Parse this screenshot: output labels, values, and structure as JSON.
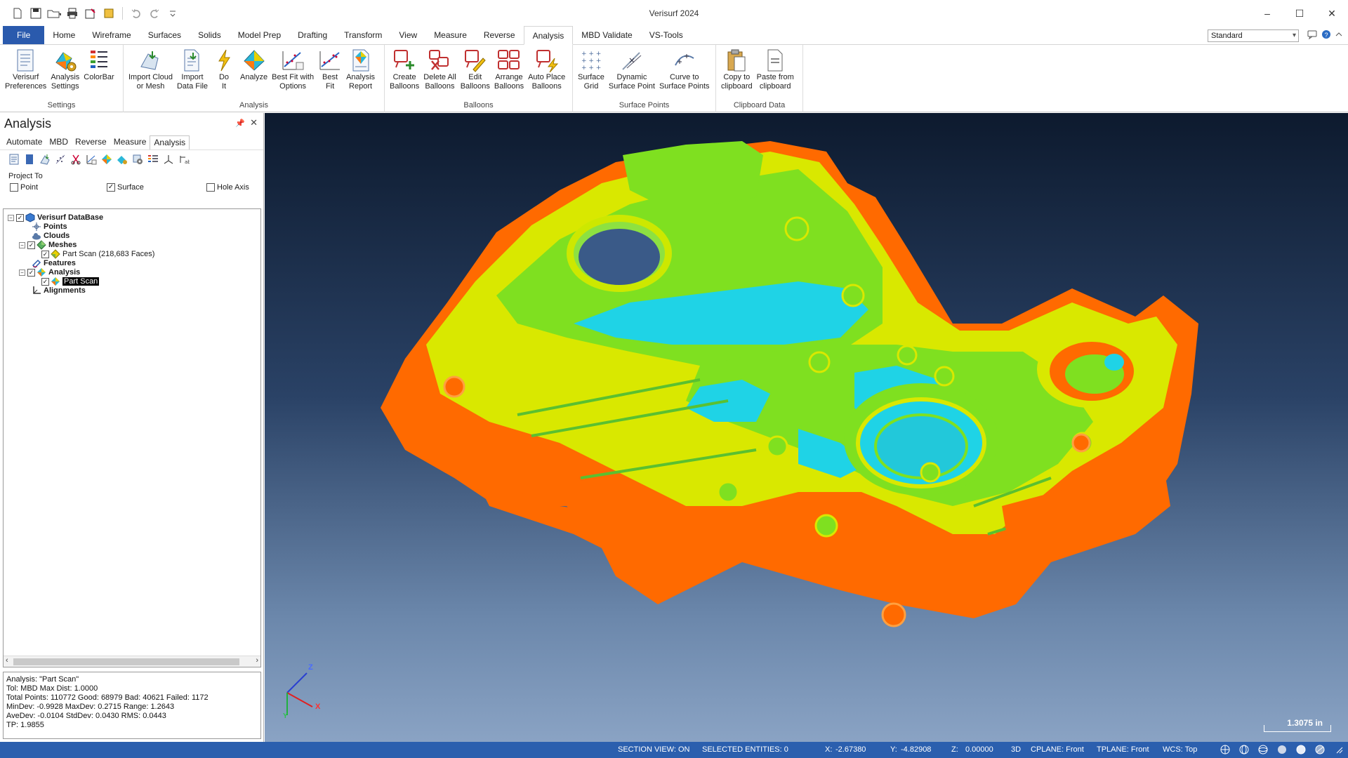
{
  "window": {
    "title": "Verisurf 2024"
  },
  "ribbon_tabs": [
    {
      "label": "File"
    },
    {
      "label": "Home"
    },
    {
      "label": "Wireframe"
    },
    {
      "label": "Surfaces"
    },
    {
      "label": "Solids"
    },
    {
      "label": "Model Prep"
    },
    {
      "label": "Drafting"
    },
    {
      "label": "Transform"
    },
    {
      "label": "View"
    },
    {
      "label": "Measure"
    },
    {
      "label": "Reverse"
    },
    {
      "label": "Analysis"
    },
    {
      "label": "MBD Validate"
    },
    {
      "label": "VS-Tools"
    }
  ],
  "style_combo": "Standard",
  "ribbon_groups": {
    "settings": {
      "label": "Settings",
      "buttons": [
        {
          "label": "Verisurf\nPreferences"
        },
        {
          "label": "Analysis\nSettings"
        },
        {
          "label": "ColorBar"
        }
      ]
    },
    "analysis": {
      "label": "Analysis",
      "buttons": [
        {
          "label": "Import Cloud\nor Mesh"
        },
        {
          "label": "Import\nData File"
        },
        {
          "label": "Do\nIt"
        },
        {
          "label": "Analyze"
        },
        {
          "label": "Best Fit with\nOptions"
        },
        {
          "label": "Best\nFit"
        },
        {
          "label": "Analysis\nReport"
        }
      ]
    },
    "balloons": {
      "label": "Balloons",
      "buttons": [
        {
          "label": "Create\nBalloons"
        },
        {
          "label": "Delete All\nBalloons"
        },
        {
          "label": "Edit\nBalloons"
        },
        {
          "label": "Arrange\nBalloons"
        },
        {
          "label": "Auto Place\nBalloons"
        }
      ]
    },
    "surface_points": {
      "label": "Surface Points",
      "buttons": [
        {
          "label": "Surface\nGrid"
        },
        {
          "label": "Dynamic\nSurface Point"
        },
        {
          "label": "Curve to\nSurface Points"
        }
      ]
    },
    "clipboard": {
      "label": "Clipboard Data",
      "buttons": [
        {
          "label": "Copy to\nclipboard"
        },
        {
          "label": "Paste from\nclipboard"
        }
      ]
    }
  },
  "panel": {
    "title": "Analysis",
    "tabs": [
      {
        "label": "Automate"
      },
      {
        "label": "MBD"
      },
      {
        "label": "Reverse"
      },
      {
        "label": "Measure"
      },
      {
        "label": "Analysis"
      }
    ],
    "project_to": {
      "title": "Project To",
      "point": "Point",
      "surface": "Surface",
      "hole_axis": "Hole Axis"
    },
    "tree": {
      "root": "Verisurf DataBase",
      "points": "Points",
      "clouds": "Clouds",
      "meshes": "Meshes",
      "mesh_item": "Part Scan (218,683 Faces)",
      "features": "Features",
      "analysis": "Analysis",
      "analysis_item": "Part Scan",
      "alignments": "Alignments"
    },
    "info": {
      "line1": "Analysis: \"Part Scan\"",
      "line2": "Tol: MBD Max Dist: 1.0000",
      "line3": "Total Points: 110772 Good: 68979 Bad: 40621 Failed: 1172",
      "line4": "MinDev: -0.9928 MaxDev: 0.2715 Range: 1.2643",
      "line5": "AveDev: -0.0104 StdDev: 0.0430 RMS: 0.0443",
      "line6": "TP: 1.9855"
    }
  },
  "viewport": {
    "scale": "1.3075 in",
    "axis_z": "Z",
    "axis_x": "X",
    "axis_y": "Y"
  },
  "status": {
    "section_view": "SECTION VIEW: ON",
    "selected": "SELECTED ENTITIES: 0",
    "x_label": "X:",
    "x_val": "-2.67380",
    "y_label": "Y:",
    "y_val": "-4.82908",
    "z_label": "Z:",
    "z_val": "0.00000",
    "mode": "3D",
    "cplane": "CPLANE: Front",
    "tplane": "TPLANE: Front",
    "wcs": "WCS: Top"
  },
  "colors": {
    "accent": "#2b5fae",
    "cyan": "#1fd3e6",
    "green": "#7fe020",
    "yellow": "#d9e800",
    "orange": "#ff6a00"
  }
}
